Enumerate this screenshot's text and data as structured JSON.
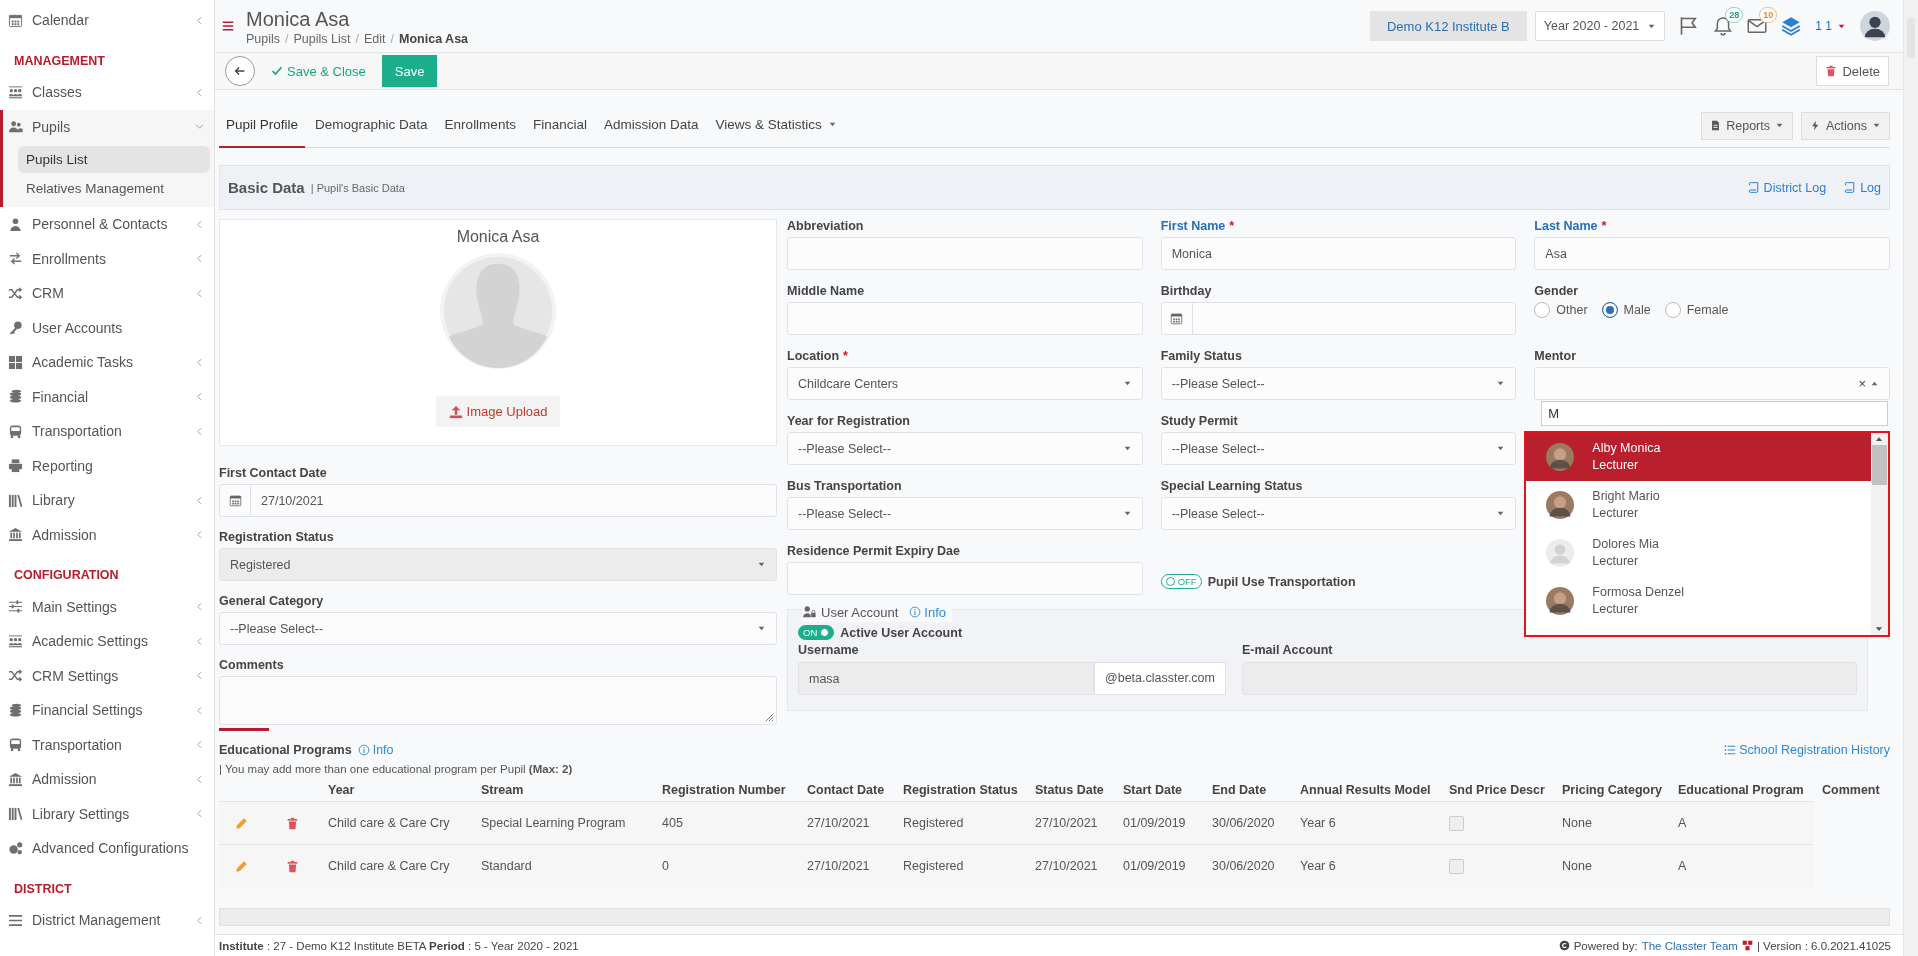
{
  "sidebar": {
    "items": [
      {
        "kind": "item",
        "label": "Calendar",
        "expanded": false
      },
      {
        "kind": "heading",
        "label": "MANAGEMENT"
      },
      {
        "kind": "item",
        "label": "Classes",
        "expanded": false
      },
      {
        "kind": "item",
        "label": "Pupils",
        "expanded": true,
        "children": [
          {
            "label": "Pupils List",
            "selected": true
          },
          {
            "label": "Relatives Management",
            "selected": false
          }
        ]
      },
      {
        "kind": "item",
        "label": "Personnel & Contacts",
        "expanded": false
      },
      {
        "kind": "item",
        "label": "Enrollments",
        "expanded": false
      },
      {
        "kind": "item",
        "label": "CRM",
        "expanded": false
      },
      {
        "kind": "item",
        "label": "User Accounts"
      },
      {
        "kind": "item",
        "label": "Academic Tasks",
        "expanded": false
      },
      {
        "kind": "item",
        "label": "Financial",
        "expanded": false
      },
      {
        "kind": "item",
        "label": "Transportation",
        "expanded": false
      },
      {
        "kind": "item",
        "label": "Reporting"
      },
      {
        "kind": "item",
        "label": "Library",
        "expanded": false
      },
      {
        "kind": "item",
        "label": "Admission",
        "expanded": false
      },
      {
        "kind": "heading",
        "label": "CONFIGURATION"
      },
      {
        "kind": "item",
        "label": "Main Settings",
        "expanded": false
      },
      {
        "kind": "item",
        "label": "Academic Settings",
        "expanded": false
      },
      {
        "kind": "item",
        "label": "CRM Settings",
        "expanded": false
      },
      {
        "kind": "item",
        "label": "Financial Settings",
        "expanded": false
      },
      {
        "kind": "item",
        "label": "Transportation",
        "expanded": false
      },
      {
        "kind": "item",
        "label": "Admission",
        "expanded": false
      },
      {
        "kind": "item",
        "label": "Library Settings",
        "expanded": false
      },
      {
        "kind": "item",
        "label": "Advanced Configurations"
      },
      {
        "kind": "heading",
        "label": "DISTRICT"
      },
      {
        "kind": "item",
        "label": "District Management",
        "expanded": false
      }
    ]
  },
  "header": {
    "title": "Monica Asa",
    "breadcrumbs": {
      "separator": "/",
      "items": [
        "Pupils",
        "Pupils List",
        "Edit",
        "Monica Asa"
      ]
    },
    "institute": "Demo K12 Institute B",
    "year": "Year 2020 - 2021",
    "notifications": "28",
    "messages": "10",
    "user": "1 1"
  },
  "toolbar": {
    "save_close": "Save & Close",
    "save": "Save",
    "delete": "Delete"
  },
  "tabs": [
    {
      "label": "Pupil Profile",
      "selected": true,
      "dropdown": false
    },
    {
      "label": "Demographic Data",
      "selected": false,
      "dropdown": false
    },
    {
      "label": "Enrollments",
      "selected": false,
      "dropdown": false
    },
    {
      "label": "Financial",
      "selected": false,
      "dropdown": false
    },
    {
      "label": "Admission Data",
      "selected": false,
      "dropdown": false
    },
    {
      "label": "Views & Statistics",
      "selected": false,
      "dropdown": true
    }
  ],
  "tab_actions": [
    "Reports",
    "Actions"
  ],
  "section": {
    "title": "Basic Data",
    "subtitle": "| Pupil's Basic Data",
    "links": [
      "District Log",
      "Log"
    ]
  },
  "form": {
    "profile": {
      "name": "Monica Asa",
      "upload": "Image Upload"
    },
    "left_fields": [
      {
        "kind": "date",
        "label": "First Contact Date",
        "value": "27/10/2021"
      },
      {
        "kind": "select",
        "label": "Registration Status",
        "value": "Registered",
        "disabled": true
      },
      {
        "kind": "select",
        "label": "General Category",
        "value": "--Please Select--",
        "disabled": false
      },
      {
        "kind": "textarea",
        "label": "Comments"
      }
    ],
    "columns": [
      [
        {
          "kind": "text",
          "label": "Abbreviation"
        },
        {
          "kind": "text",
          "label": "Middle Name"
        },
        {
          "kind": "select",
          "label": "Location",
          "required_mark": "*",
          "value": "Childcare Centers",
          "disabled": false
        },
        {
          "kind": "select",
          "label": "Year for Registration",
          "value": "--Please Select--",
          "disabled": false
        },
        {
          "kind": "select",
          "label": "Bus Transportation",
          "value": "--Please Select--",
          "disabled": false
        },
        {
          "kind": "text",
          "label": "Residence Permit Expiry Dae"
        }
      ],
      [
        {
          "kind": "text",
          "label": "First Name",
          "required_mark": "*",
          "highlighted": true,
          "value": "Monica"
        },
        {
          "kind": "date",
          "label": "Birthday"
        },
        {
          "kind": "select",
          "label": "Family Status",
          "value": "--Please Select--",
          "disabled": false
        },
        {
          "kind": "select",
          "label": "Study Permit",
          "value": "--Please Select--",
          "disabled": false
        },
        {
          "kind": "select",
          "label": "Special Learning Status",
          "value": "--Please Select--",
          "disabled": false
        },
        {
          "kind": "toggle",
          "label": "Pupil Use Transportation",
          "on": false,
          "state_text": "OFF"
        }
      ],
      [
        {
          "kind": "text",
          "label": "Last Name",
          "required_mark": "*",
          "highlighted": true,
          "value": "Asa"
        },
        {
          "kind": "radio",
          "label": "Gender",
          "options": [
            {
              "label": "Other",
              "selected": false
            },
            {
              "label": "Male",
              "selected": true
            },
            {
              "label": "Female",
              "selected": false
            }
          ]
        },
        {
          "kind": "combo",
          "label": "Mentor",
          "clear": "×",
          "open": true,
          "search": "M",
          "options": [
            {
              "kind": "photo",
              "name": "Alby Monica",
              "role": "Lecturer",
              "selected": true
            },
            {
              "kind": "photo",
              "name": "Bright Mario",
              "role": "Lecturer",
              "selected": false
            },
            {
              "kind": "blank",
              "name": "Dolores Mia",
              "role": "Lecturer",
              "selected": false
            },
            {
              "kind": "photo",
              "name": "Formosa Denzel",
              "role": "Lecturer",
              "selected": false
            }
          ]
        }
      ]
    ],
    "user_account": {
      "title": "User Account",
      "info": "Info",
      "active": {
        "label": "Active User Account",
        "on": true,
        "state_text": "ON"
      },
      "username": {
        "label": "Username",
        "value": "masa",
        "suffix": "@beta.classter.com",
        "disabled": true
      },
      "email": {
        "label": "E-mail Account",
        "disabled": true
      }
    }
  },
  "educational_programs": {
    "title": "Educational Programs",
    "info": "Info",
    "history_link": "School Registration History",
    "note": "| You may add more than one educational program per Pupil **(Max: 2)**",
    "columns": [
      "Year",
      "Stream",
      "Registration Number",
      "Contact Date",
      "Registration Status",
      "Status Date",
      "Start Date",
      "End Date",
      "Annual Results Model",
      "Snd Price Descr",
      "Pricing Category",
      "Educational Program",
      "Comment"
    ],
    "rows": [
      {
        "cells": [
          "Child care & Care Cry",
          "Special Learning Program",
          "405",
          "27/10/2021",
          "Registered",
          "27/10/2021",
          "01/09/2019",
          "30/06/2020",
          "Year 6",
          {
            "kind": "checkbox",
            "checked": false
          },
          "None",
          "A"
        ]
      },
      {
        "cells": [
          "Child care & Care Cry",
          "Standard",
          "0",
          "27/10/2021",
          "Registered",
          "27/10/2021",
          "01/09/2019",
          "30/06/2020",
          "Year 6",
          {
            "kind": "checkbox",
            "checked": false
          },
          "None",
          "A"
        ]
      }
    ]
  },
  "footer": {
    "info": "**Institute** : 27 - Demo K12 Institute BETA **Period** : 5 - Year 2020 - 2021",
    "powered": "Powered by:",
    "team": "The Classter Team",
    "version": "| Version : 6.0.2021.41025"
  }
}
